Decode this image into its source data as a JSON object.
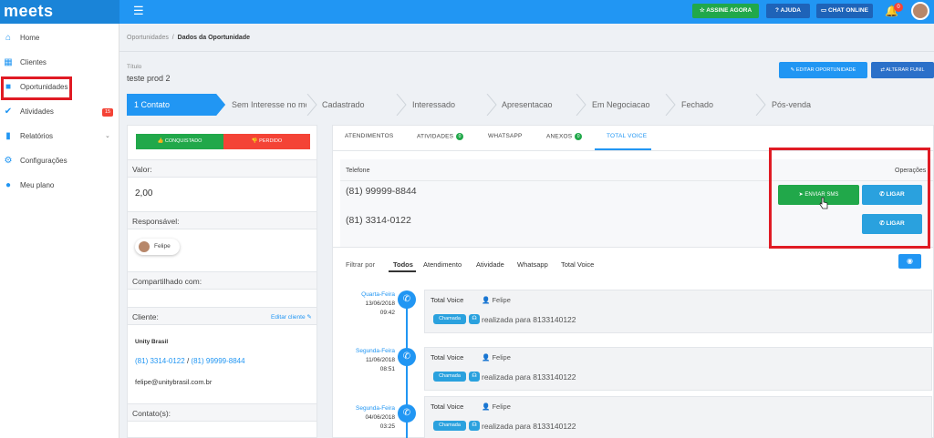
{
  "app": {
    "logo": "meets",
    "menu_icon": "menu-icon",
    "top_buttons": {
      "assine": "ASSINE AGORA",
      "ajuda": "AJUDA",
      "chat": "CHAT ONLINE"
    },
    "notification_count": "0"
  },
  "sidebar": {
    "items": [
      {
        "label": "Home",
        "icon": "home-icon"
      },
      {
        "label": "Clientes",
        "icon": "building-icon"
      },
      {
        "label": "Oportunidades",
        "icon": "briefcase-icon"
      },
      {
        "label": "Atividades",
        "icon": "check-shield-icon",
        "badge": "15"
      },
      {
        "label": "Relatórios",
        "icon": "bar-chart-icon"
      },
      {
        "label": "Configurações",
        "icon": "gear-icon"
      },
      {
        "label": "Meu plano",
        "icon": "user-icon"
      }
    ]
  },
  "breadcrumb": {
    "parent": "Oportunidades",
    "current": "Dados da Oportunidade"
  },
  "header": {
    "title_label": "Título",
    "title_value": "teste prod 2",
    "edit_button": "EDITAR OPORTUNIDADE",
    "funil_button": "ALTERAR FUNIL"
  },
  "pipeline": {
    "stages": [
      "1 Contato",
      "Sem Interesse no mo",
      "Cadastrado",
      "Interessado",
      "Apresentacao",
      "Em Negociacao",
      "Fechado",
      "Pós-venda"
    ],
    "active_index": 0
  },
  "left_panel": {
    "conquistado": "CONQUISTADO",
    "perdido": "PERDIDO",
    "valor_label": "Valor:",
    "valor_value": "2,00",
    "responsavel_label": "Responsável:",
    "responsavel_name": "Felipe",
    "compartilhado_label": "Compartilhado com:",
    "cliente_label": "Cliente:",
    "editar_cliente": "Editar cliente",
    "cliente_name": "Unity Brasil",
    "cliente_phone1": "(81) 3314-0122",
    "cliente_phone_sep": "/",
    "cliente_phone2": "(81) 99999-8844",
    "cliente_email": "felipe@unitybrasil.com.br",
    "contatos_label": "Contato(s):"
  },
  "right_panel": {
    "tabs": [
      {
        "label": "ATENDIMENTOS"
      },
      {
        "label": "ATIVIDADES",
        "badge": "0"
      },
      {
        "label": "WHATSAPP"
      },
      {
        "label": "ANEXOS",
        "badge": "0"
      },
      {
        "label": "TOTAL VOICE"
      }
    ],
    "active_tab": "TOTAL VOICE",
    "telefone_label": "Telefone",
    "operacoes_label": "Operações",
    "phones": [
      "(81) 99999-8844",
      "(81) 3314-0122"
    ],
    "enviar_sms": "ENVIAR SMS",
    "ligar": "LIGAR",
    "filter_label": "Filtrar por",
    "filters": [
      "Todos",
      "Atendimento",
      "Atividade",
      "Whatsapp",
      "Total Voice"
    ],
    "active_filter": "Todos",
    "timeline": [
      {
        "day": "Quarta-Feira",
        "date": "13/06/2018",
        "time": "09:42",
        "source": "Total Voice",
        "user": "Felipe",
        "chip": "Chamada",
        "desc": "realizada para 8133140122"
      },
      {
        "day": "Segunda-Feira",
        "date": "11/06/2018",
        "time": "08:51",
        "source": "Total Voice",
        "user": "Felipe",
        "chip": "Chamada",
        "desc": "realizada para 8133140122"
      },
      {
        "day": "Segunda-Feira",
        "date": "04/06/2018",
        "time": "03:25",
        "source": "Total Voice",
        "user": "Felipe",
        "chip": "Chamada",
        "desc": "realizada para 8133140122"
      }
    ]
  },
  "colors": {
    "primary": "#2196f3",
    "success": "#21a84a",
    "danger": "#f44336",
    "highlight": "#e01b24"
  }
}
